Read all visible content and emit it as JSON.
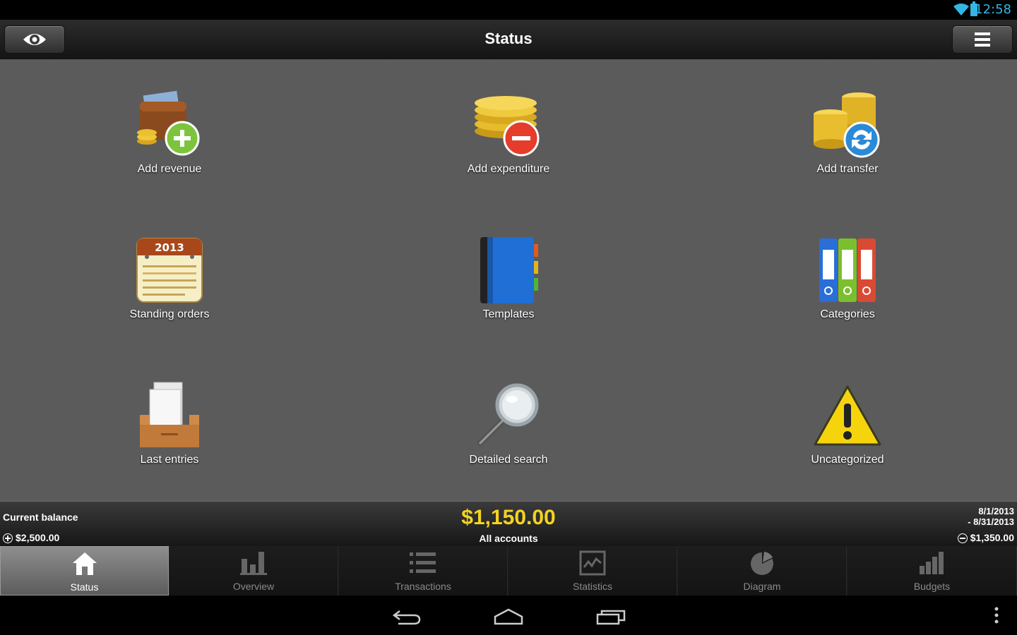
{
  "system": {
    "time": "12:58"
  },
  "titlebar": {
    "title": "Status"
  },
  "tiles": [
    {
      "label": "Add revenue"
    },
    {
      "label": "Add expenditure"
    },
    {
      "label": "Add transfer"
    },
    {
      "label": "Standing orders",
      "calendar_year": "2013"
    },
    {
      "label": "Templates"
    },
    {
      "label": "Categories"
    },
    {
      "label": "Last entries"
    },
    {
      "label": "Detailed search"
    },
    {
      "label": "Uncategorized"
    }
  ],
  "balance": {
    "label": "Current balance",
    "revenue": "$2,500.00",
    "amount": "$1,150.00",
    "accounts": "All accounts",
    "date_from": "8/1/2013",
    "date_to": "- 8/31/2013",
    "expenditure": "$1,350.00",
    "amount_color": "#f4d320"
  },
  "tabs": [
    {
      "label": "Status",
      "active": true
    },
    {
      "label": "Overview"
    },
    {
      "label": "Transactions"
    },
    {
      "label": "Statistics"
    },
    {
      "label": "Diagram"
    },
    {
      "label": "Budgets"
    }
  ],
  "colors": {
    "accent": "#33b5e5",
    "main_bg": "#5b5b5b"
  }
}
